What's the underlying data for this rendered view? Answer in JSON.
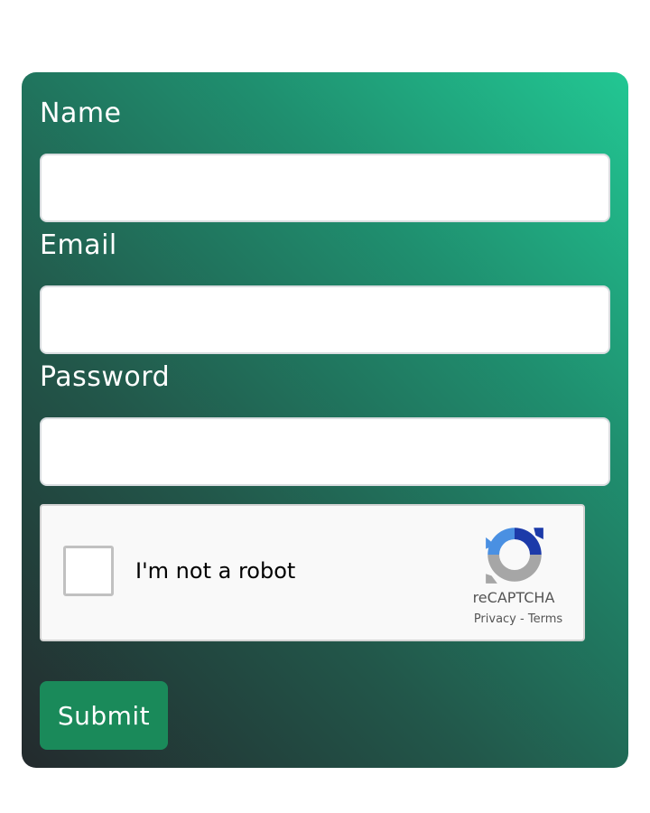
{
  "form": {
    "name_label": "Name",
    "name_value": "",
    "email_label": "Email",
    "email_value": "",
    "password_label": "Password",
    "password_value": "",
    "submit_label": "Submit"
  },
  "recaptcha": {
    "label": "I'm not a robot",
    "brand": "reCAPTCHA",
    "privacy": "Privacy",
    "separator": "-",
    "terms": "Terms",
    "checked": false
  },
  "colors": {
    "gradient_start": "#232a2d",
    "gradient_mid": "#1f8f6f",
    "gradient_end": "#22c793",
    "submit_bg": "#1a8a5a",
    "label_text": "#ffffff"
  },
  "icons": {
    "recaptcha_logo": "recaptcha-logo-icon"
  }
}
